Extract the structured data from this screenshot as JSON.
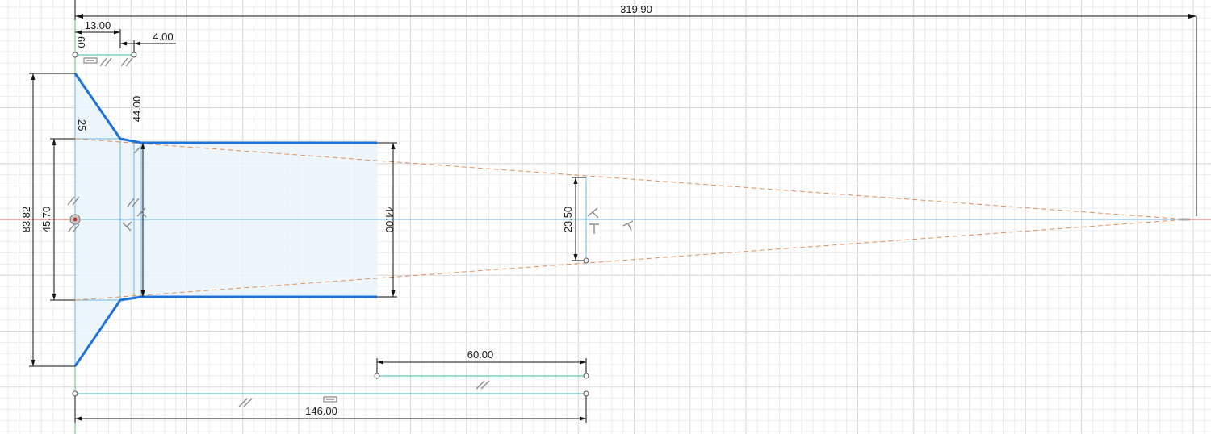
{
  "dimensions": {
    "overall_length": "319.90",
    "top_offset": "13.00",
    "small_step": "4.00",
    "tiny_label_top": "60",
    "chamfer_height": "44.00",
    "angle_label": "25",
    "outer_height": "83.82",
    "inner_height": "45.70",
    "body_height": "44.00",
    "cone_radius": "23.50",
    "bottom_segment": "60.00",
    "body_length": "146.00"
  },
  "colors": {
    "profile": "#1e73d8",
    "construction": "#e0915a",
    "fill": "#eaf4fb",
    "grid_minor": "#ececec",
    "grid_major": "#d7d7d7"
  }
}
